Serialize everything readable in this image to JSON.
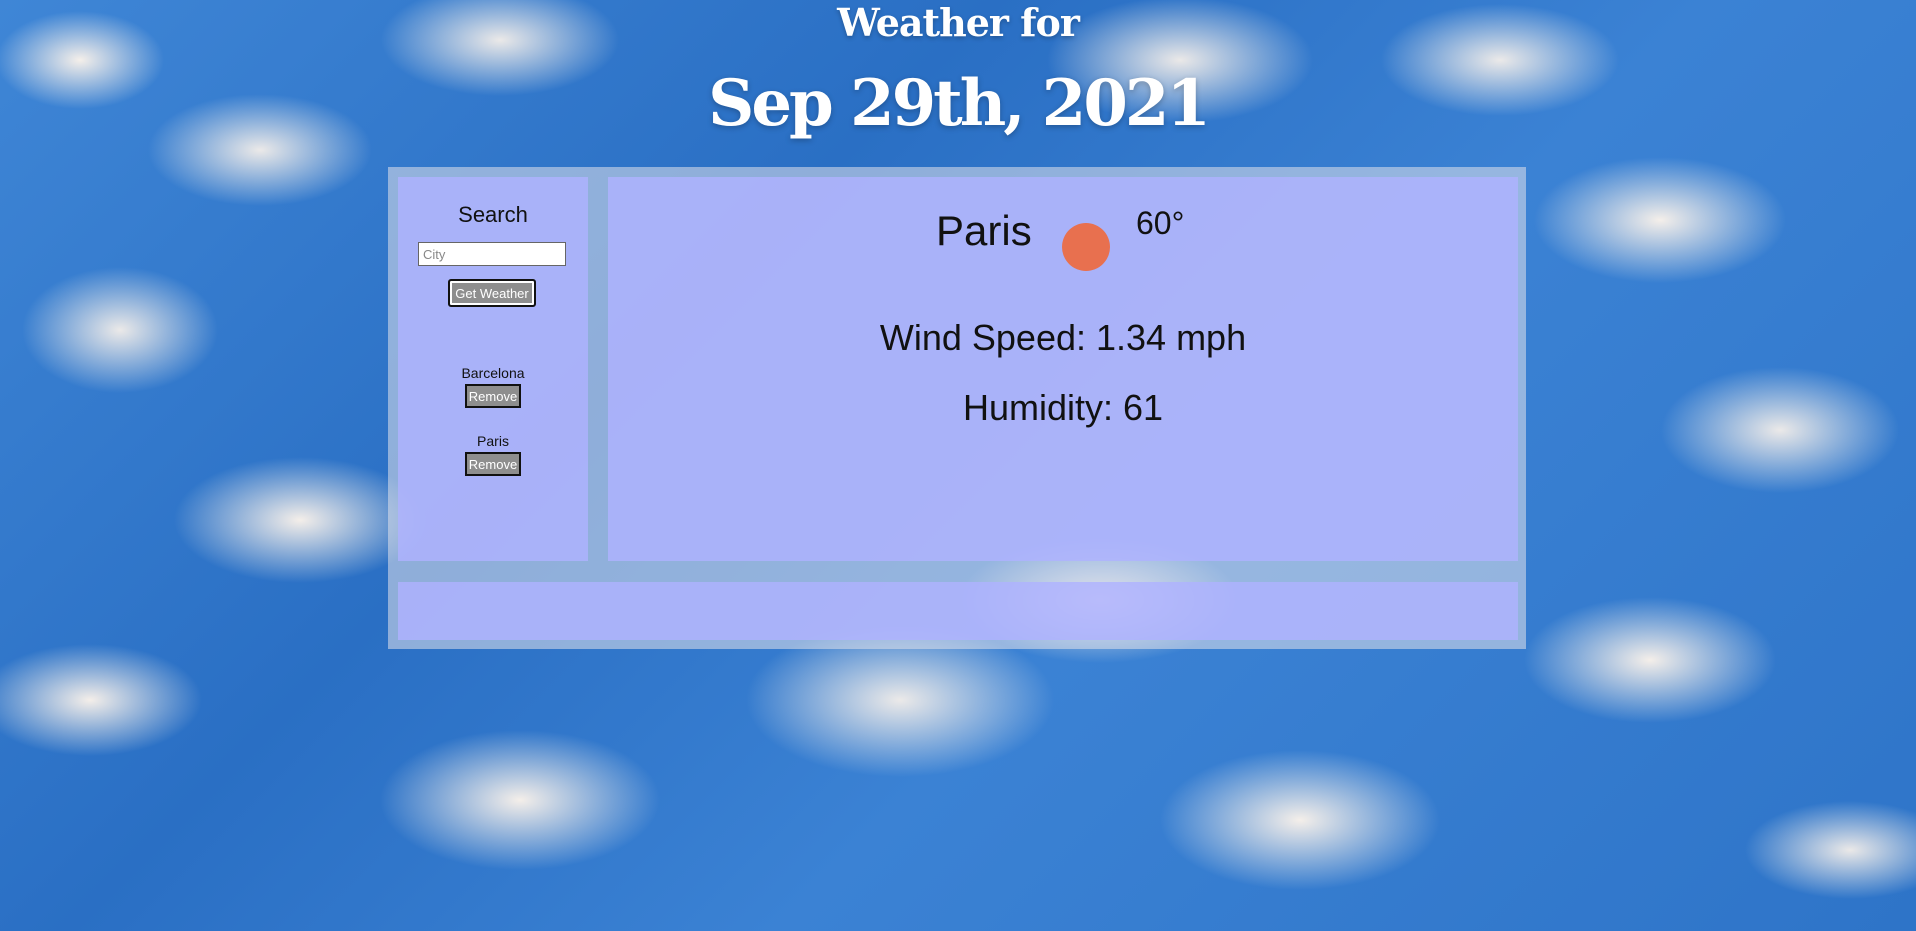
{
  "header": {
    "title": "Weather for",
    "date": "Sep 29th, 2021"
  },
  "search": {
    "title": "Search",
    "placeholder": "City",
    "value": "",
    "button_label": "Get Weather"
  },
  "saved_cities": [
    {
      "name": "Barcelona",
      "remove_label": "Remove"
    },
    {
      "name": "Paris",
      "remove_label": "Remove"
    }
  ],
  "current": {
    "city": "Paris",
    "icon": "sun-icon",
    "icon_color": "#e8704f",
    "temperature": "60°",
    "wind_speed": "Wind Speed: 1.34 mph",
    "humidity": "Humidity: 61"
  }
}
